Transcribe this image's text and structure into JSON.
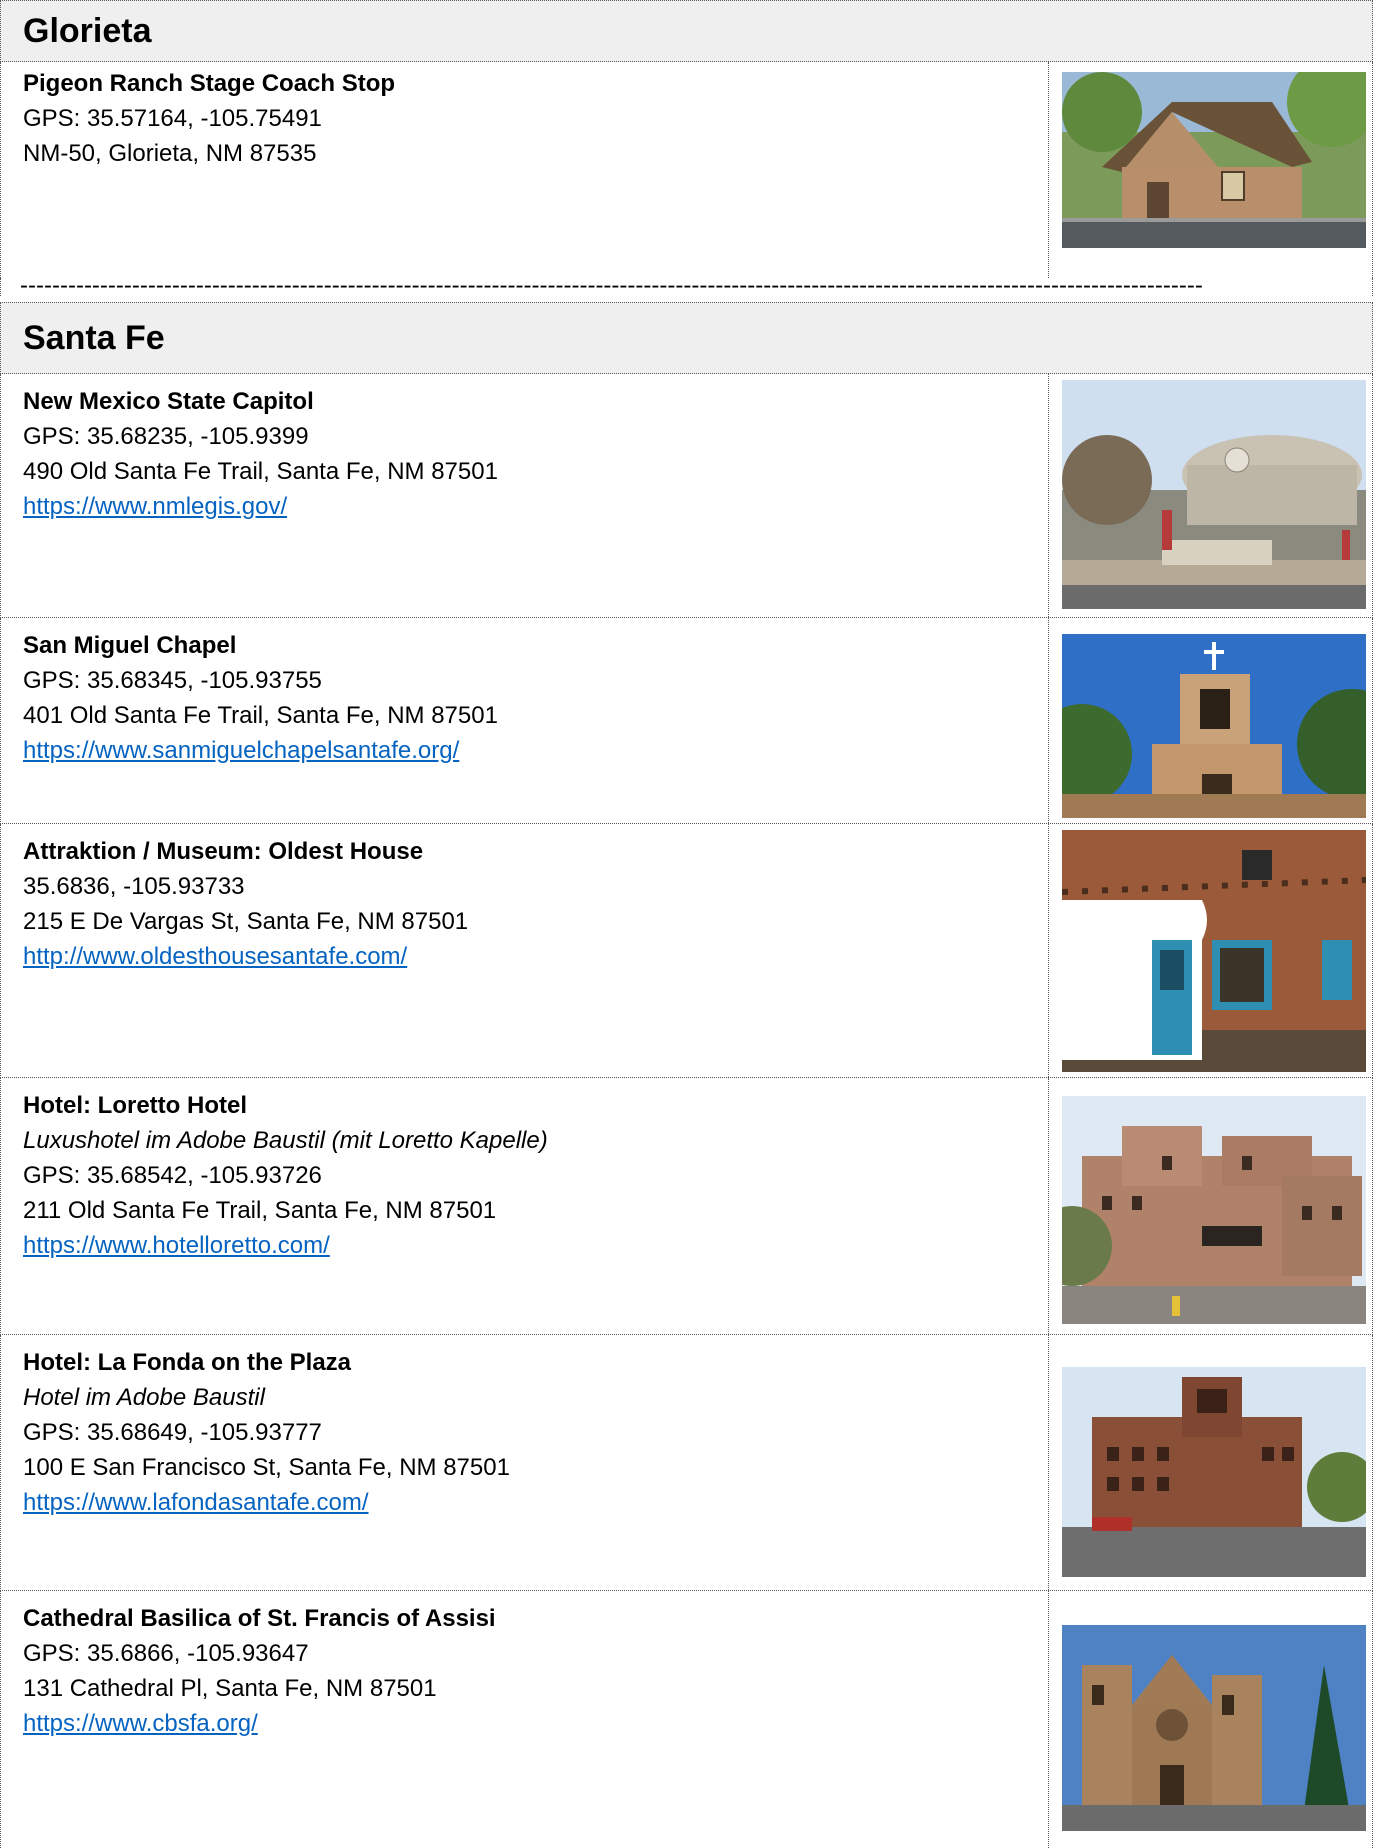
{
  "sections": [
    {
      "heading": "Glorieta",
      "entries": [
        {
          "title": "Pigeon Ranch Stage Coach Stop",
          "lines": [
            "GPS: 35.57164, -105.75491",
            "NM-50, Glorieta, NM 87535"
          ],
          "photo_alt": "Pigeon Ranch adobe building with wooden roof"
        }
      ]
    },
    {
      "heading": "Santa Fe",
      "entries": [
        {
          "title": "New Mexico State Capitol",
          "lines": [
            "GPS: 35.68235, -105.9399",
            "490 Old Santa Fe Trail, Santa Fe, NM 87501"
          ],
          "link": "https://www.nmlegis.gov/"
        },
        {
          "title": "San Miguel Chapel",
          "lines": [
            "GPS: 35.68345, -105.93755",
            "401 Old Santa Fe Trail, Santa Fe, NM 87501"
          ],
          "link": "https://www.sanmiguelchapelsantafe.org/"
        },
        {
          "title": "Attraktion / Museum: Oldest House",
          "lines": [
            "35.6836, -105.93733",
            "215 E De Vargas St, Santa Fe, NM 87501"
          ],
          "link": "http://www.oldesthousesantafe.com/"
        },
        {
          "title": "Hotel: Loretto Hotel",
          "subtitle": "Luxushotel im Adobe Baustil (mit Loretto Kapelle)",
          "lines": [
            "GPS: 35.68542, -105.93726",
            "211 Old Santa Fe Trail, Santa Fe, NM 87501"
          ],
          "link": "https://www.hotelloretto.com/"
        },
        {
          "title": "Hotel: La Fonda on the Plaza",
          "subtitle": "Hotel im Adobe Baustil",
          "lines": [
            "GPS: 35.68649, -105.93777",
            "100 E San Francisco St, Santa Fe, NM 87501"
          ],
          "link": "https://www.lafondasantafe.com/"
        },
        {
          "title": "Cathedral Basilica of St. Francis of Assisi",
          "lines": [
            "GPS: 35.6866, -105.93647",
            "131 Cathedral Pl, Santa Fe, NM 87501"
          ],
          "link": "https://www.cbsfa.org/"
        }
      ]
    }
  ],
  "separator": "----------------------------------------------------------------------------------------------------------------------------------------------------"
}
